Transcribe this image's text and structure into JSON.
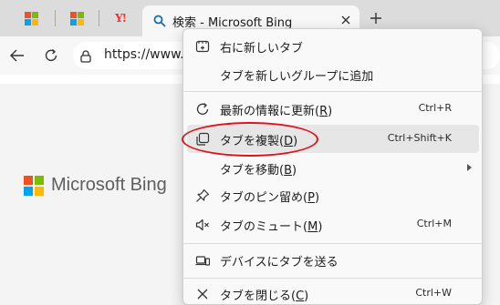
{
  "tabs": {
    "active_title": "検索 - Microsoft Bing",
    "icons": [
      "microsoft-favicon",
      "microsoft-favicon",
      "yahoo-favicon"
    ],
    "yahoo_glyph": "Y!"
  },
  "address_bar": {
    "url": "https://www.b"
  },
  "page": {
    "brand": "Microsoft Bing"
  },
  "brand_colors": {
    "red": "#f25022",
    "green": "#7fba00",
    "blue": "#00a4ef",
    "yellow": "#ffb900"
  },
  "context_menu": {
    "items": [
      {
        "label": "右に新しいタブ",
        "shortcut": "",
        "icon": "new-tab-right-icon"
      },
      {
        "label": "タブを新しいグループに追加",
        "shortcut": "",
        "icon": ""
      },
      {
        "label": "最新の情報に更新",
        "mnemonic": "R",
        "shortcut": "Ctrl+R",
        "icon": "refresh-icon"
      },
      {
        "label": "タブを複製",
        "mnemonic": "D",
        "shortcut": "Ctrl+Shift+K",
        "icon": "duplicate-icon",
        "highlighted": true
      },
      {
        "label": "タブを移動",
        "mnemonic": "B",
        "shortcut": "",
        "icon": "",
        "submenu": true
      },
      {
        "label": "タブのピン留め",
        "mnemonic": "P",
        "shortcut": "",
        "icon": "pin-icon"
      },
      {
        "label": "タブのミュート",
        "mnemonic": "M",
        "shortcut": "Ctrl+M",
        "icon": "mute-icon"
      },
      {
        "label": "デバイスにタブを送る",
        "shortcut": "",
        "icon": "send-device-icon"
      },
      {
        "label": "タブを閉じる",
        "mnemonic": "C",
        "shortcut": "Ctrl+W",
        "icon": "close-icon"
      }
    ]
  },
  "annotation_color": "#e0121a"
}
